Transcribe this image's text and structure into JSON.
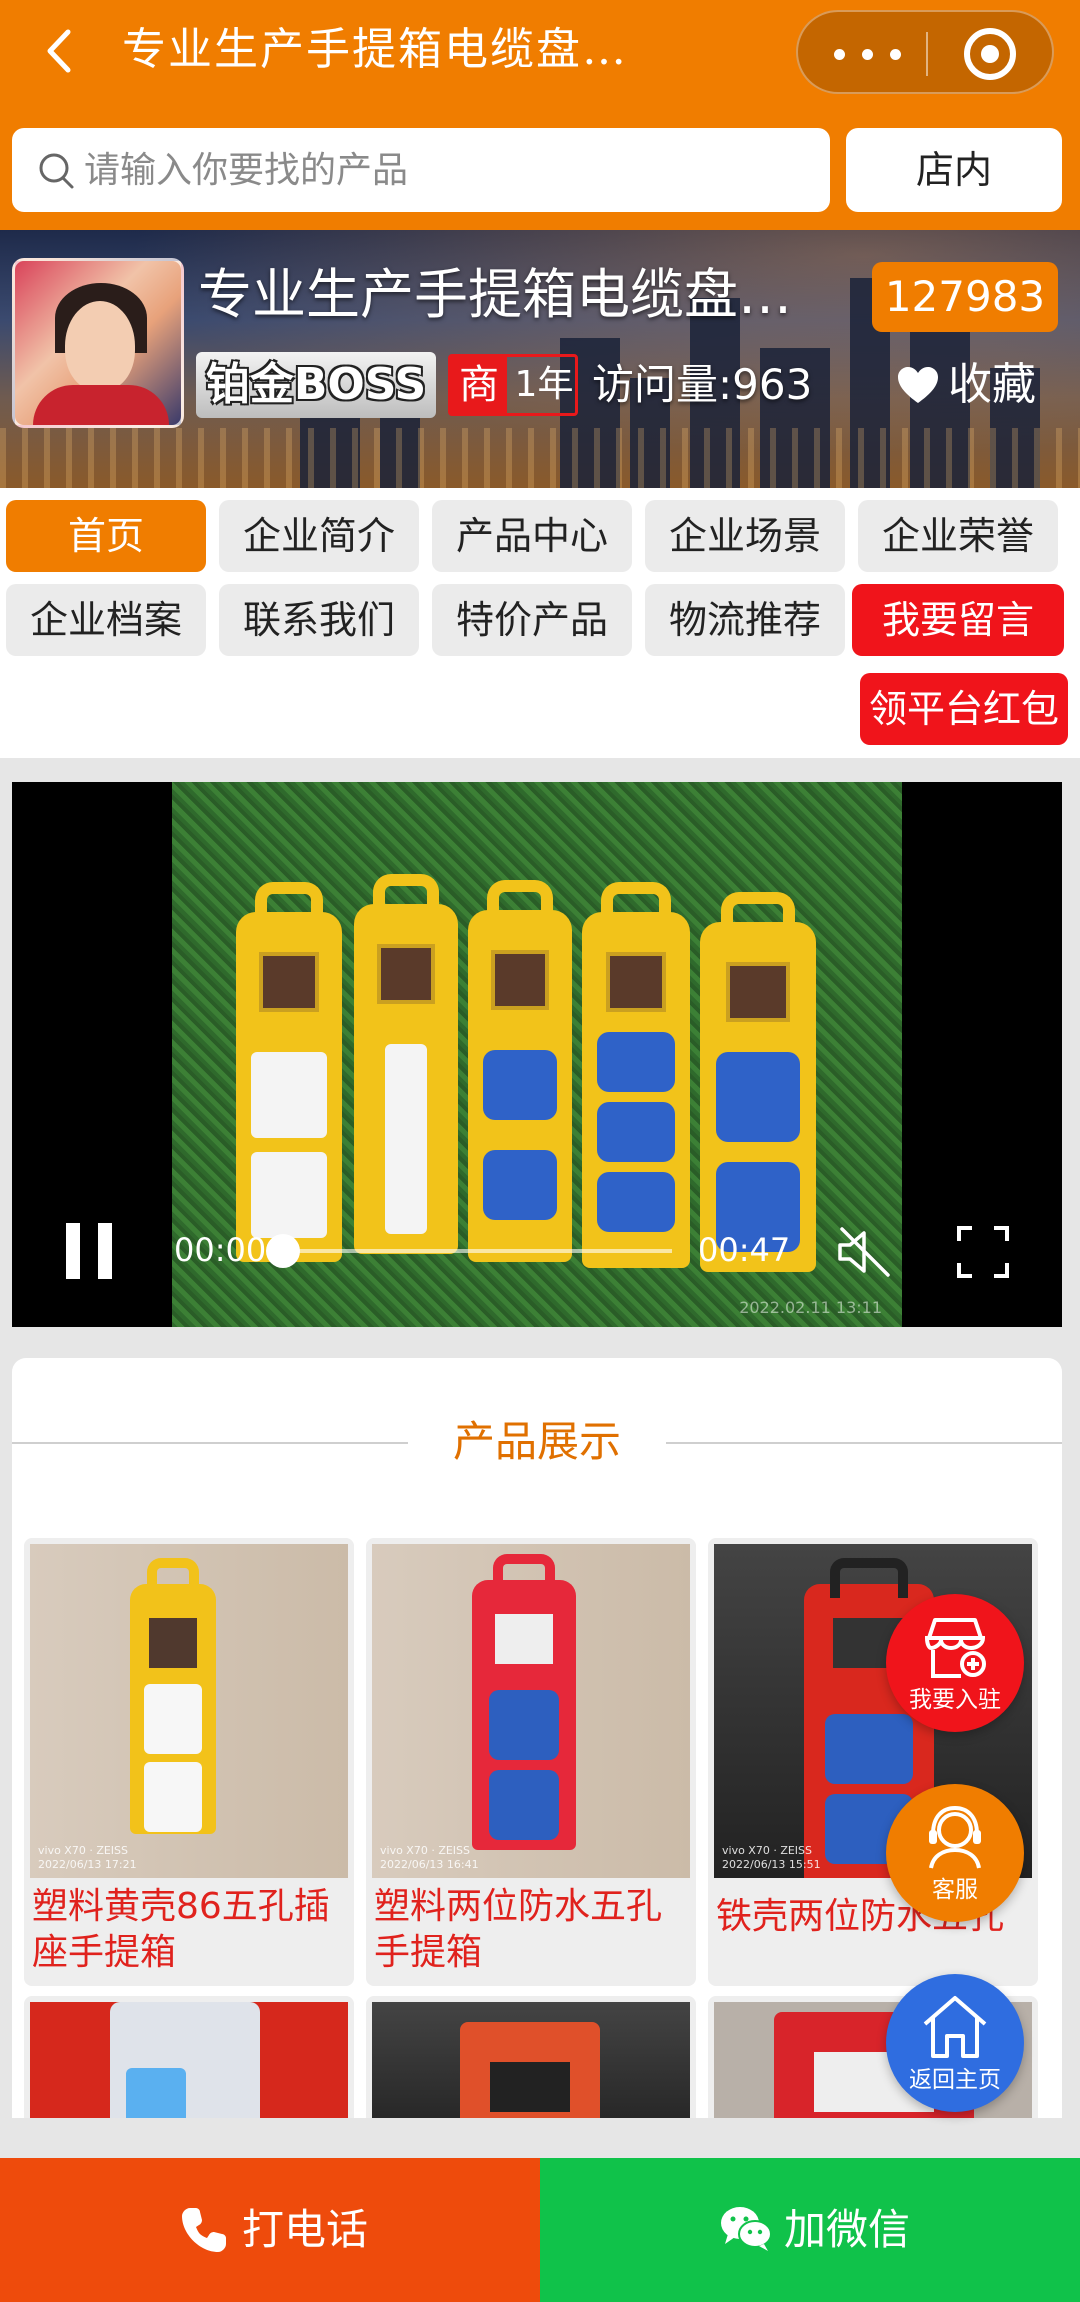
{
  "nav": {
    "title": "专业生产手提箱电缆盘…"
  },
  "search": {
    "placeholder": "请输入你要找的产品",
    "scope_label": "店内"
  },
  "store": {
    "name": "专业生产手提箱电缆盘…",
    "id": "127983",
    "level": "铂金BOSS",
    "merchant_icon": "商",
    "years": "1年",
    "visits": "访问量:963",
    "favorite_label": "收藏"
  },
  "menu": {
    "items": [
      {
        "label": "首页",
        "active": true
      },
      {
        "label": "企业简介"
      },
      {
        "label": "产品中心"
      },
      {
        "label": "企业场景"
      },
      {
        "label": "企业荣誉"
      },
      {
        "label": "企业档案"
      },
      {
        "label": "联系我们"
      },
      {
        "label": "特价产品"
      },
      {
        "label": "物流推荐"
      },
      {
        "label": "我要留言",
        "highlight": "red"
      },
      {
        "label": "领平台红包",
        "highlight": "red"
      }
    ]
  },
  "video": {
    "current_time": "00:00",
    "duration": "00:47",
    "progress": 0,
    "watermark": "2022.02.11 13:11"
  },
  "products": {
    "section_title": "产品展示",
    "items": [
      {
        "name": "塑料黄壳86五孔插座手提箱",
        "photo_mark": "vivo X70 · ZEISS\n2022/06/13 17:21"
      },
      {
        "name": "塑料两位防水五孔手提箱",
        "photo_mark": "vivo X70 · ZEISS\n2022/06/13 16:41"
      },
      {
        "name": "铁壳两位防水五孔",
        "photo_mark": "vivo X70 · ZEISS\n2022/06/13 15:51"
      }
    ]
  },
  "floating": {
    "join_label": "我要入驻",
    "service_label": "客服",
    "home_label": "返回主页"
  },
  "bottom": {
    "call_label": "打电话",
    "wechat_label": "加微信"
  },
  "colors": {
    "brand_orange": "#f07d00",
    "alert_red": "#f0141b",
    "call_orange": "#ee4b0c",
    "wechat_green": "#10c24a",
    "home_blue": "#2f6de0"
  }
}
